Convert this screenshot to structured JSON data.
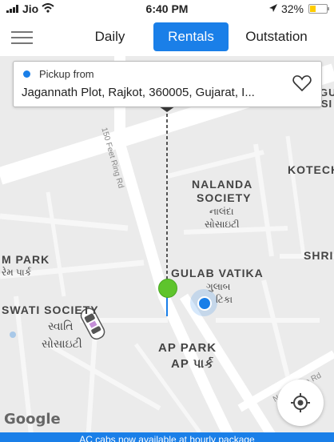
{
  "status_bar": {
    "carrier": "Jio",
    "time": "6:40 PM",
    "battery": "32%"
  },
  "nav": {
    "tabs": [
      {
        "label": "Daily"
      },
      {
        "label": "Rentals"
      },
      {
        "label": "Outstation"
      }
    ],
    "active_tab": "Rentals"
  },
  "pickup": {
    "title": "Pickup from",
    "address": "Jagannath Plot, Rajkot, 360005, Gujarat, I..."
  },
  "map": {
    "labels": {
      "nalanda": "NALANDA",
      "society": "SOCIETY",
      "nalanda_guj": "નાલંદા",
      "society_guj": "સોસાઇટી",
      "gulab": "GULAB VATIKA",
      "gulab_guj1": "ગુલાબ",
      "gulab_guj2": "ટિકા",
      "mpark": "M PARK",
      "mpark_guj": "રેમ પાર્ક",
      "swati": "SWATI SOCIETY",
      "swati_guj1": "સ્વાતિ",
      "swati_guj2": "સોસાઇટી",
      "ap_park": "AP PARK",
      "ap_park_guj": "AP પાર્ક",
      "kotech": "KOTECH",
      "hous": "HOUSI",
      "gu": "GU",
      "shri": "SHRI",
      "road_ring": "150 Feet Ring Rd",
      "road_maya": "Nana Mava Rd"
    },
    "logo": "Google"
  },
  "banner": {
    "text": "AC cabs now available at hourly package"
  },
  "colors": {
    "accent": "#1a7fe8",
    "green_pin": "#5ec42c"
  },
  "icons": {
    "menu": "hamburger-icon",
    "favorite": "heart-icon",
    "locate": "crosshair-icon",
    "car": "car-icon"
  }
}
